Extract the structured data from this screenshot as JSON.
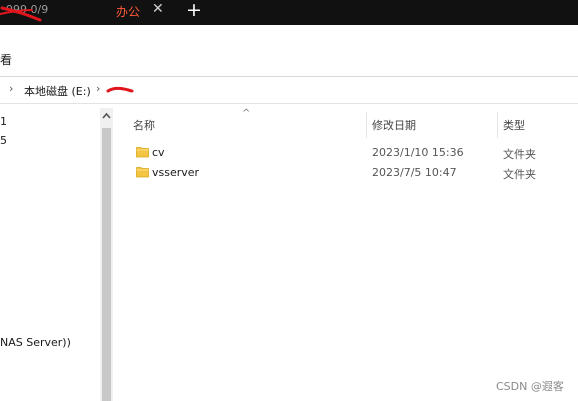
{
  "tabs": {
    "inactive_label": "999 0/9",
    "active_label": "办公",
    "close_glyph": "✕",
    "new_tab_glyph": "+"
  },
  "menu": {
    "view_label": "看"
  },
  "address": {
    "chevron": "›",
    "drive_label": "本地磁盘 (E:)"
  },
  "nav_pane": {
    "items": [
      "1",
      "5",
      "NAS Server))"
    ]
  },
  "columns": {
    "name": "名称",
    "modified": "修改日期",
    "type": "类型",
    "sort_caret": "^"
  },
  "files": [
    {
      "name": "cv",
      "modified": "2023/1/10 15:36",
      "type": "文件夹"
    },
    {
      "name": "vsserver",
      "modified": "2023/7/5 10:47",
      "type": "文件夹"
    }
  ],
  "watermark": "CSDN @遐客",
  "colors": {
    "active_tab": "#ff5a3c",
    "folder": "#f4c542",
    "redaction": "#e0161d"
  }
}
